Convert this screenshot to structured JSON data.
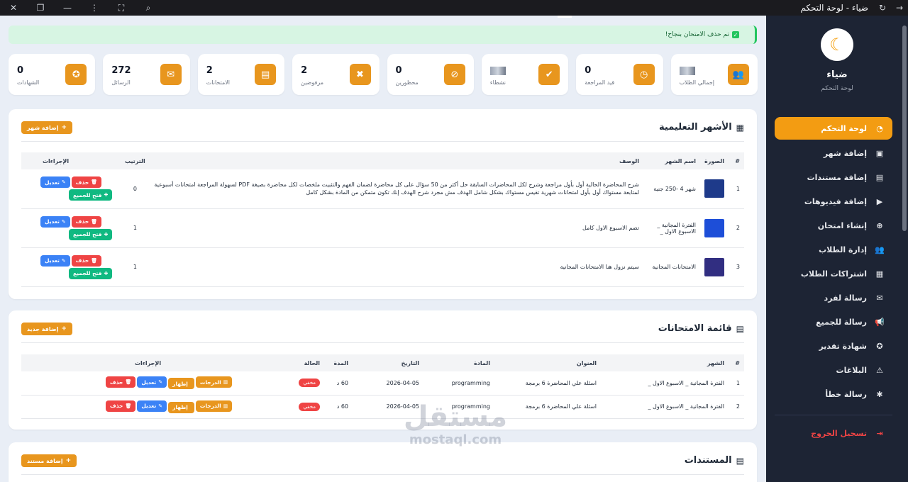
{
  "window": {
    "title": "ضياء - لوحة التحكم",
    "controls": {
      "close": "✕",
      "restore": "❐",
      "minimize": "—",
      "more": "⋮",
      "crop": "⛶",
      "zoom": "⌕"
    },
    "nav": {
      "refresh": "↻",
      "forward": "→"
    }
  },
  "sidebar": {
    "name": "ضياء",
    "subtitle": "لوحة التحكم",
    "items": [
      {
        "label": "لوحة التحكم",
        "icon": "gauge-icon",
        "glyph": "◔",
        "active": true
      },
      {
        "label": "إضافة شهر",
        "icon": "calendar-plus-icon",
        "glyph": "▣"
      },
      {
        "label": "إضافة مستندات",
        "icon": "file-icon",
        "glyph": "▤"
      },
      {
        "label": "إضافة فيديوهات",
        "icon": "video-icon",
        "glyph": "▶"
      },
      {
        "label": "إنشاء امتحان",
        "icon": "plus-circle-icon",
        "glyph": "⊕"
      },
      {
        "label": "إدارة الطلاب",
        "icon": "users-icon",
        "glyph": "👥"
      },
      {
        "label": "اشتراكات الطلاب",
        "icon": "calendar-check-icon",
        "glyph": "▦"
      },
      {
        "label": "رسالة لفرد",
        "icon": "envelope-icon",
        "glyph": "✉"
      },
      {
        "label": "رسالة للجميع",
        "icon": "bullhorn-icon",
        "glyph": "📢"
      },
      {
        "label": "شهادة تقدير",
        "icon": "award-icon",
        "glyph": "✪"
      },
      {
        "label": "البلاغات",
        "icon": "warning-icon",
        "glyph": "⚠"
      },
      {
        "label": "رسالة خطأ",
        "icon": "bug-icon",
        "glyph": "✱"
      }
    ],
    "logout": "تسجيل الخروج"
  },
  "alert": {
    "text": "تم حذف الامتحان بنجاح!"
  },
  "stats": [
    {
      "label": "إجمالي الطلاب",
      "value": "",
      "icon": "users-icon",
      "glyph": "👥",
      "blurred": true
    },
    {
      "label": "قيد المراجعة",
      "value": "0",
      "icon": "clock-icon",
      "glyph": "◷"
    },
    {
      "label": "نشطاء",
      "value": "",
      "icon": "user-check-icon",
      "glyph": "✔",
      "blurred": true
    },
    {
      "label": "محظورين",
      "value": "0",
      "icon": "ban-icon",
      "glyph": "⊘"
    },
    {
      "label": "مرفوضين",
      "value": "2",
      "icon": "x-circle-icon",
      "glyph": "✖"
    },
    {
      "label": "الامتحانات",
      "value": "2",
      "icon": "file-alt-icon",
      "glyph": "▤"
    },
    {
      "label": "الرسائل",
      "value": "272",
      "icon": "envelope-icon",
      "glyph": "✉"
    },
    {
      "label": "الشهادات",
      "value": "0",
      "icon": "certificate-icon",
      "glyph": "✪"
    }
  ],
  "months": {
    "title": "الأشهر التعليمية",
    "add_label": "إضافة شهر",
    "headers": [
      "#",
      "الصورة",
      "اسم الشهر",
      "الوصف",
      "الترتيب",
      "الإجراءات"
    ],
    "rows": [
      {
        "num": "1",
        "name": "شهر 4 -250 جنية",
        "desc": "شرح المحاضرة الحالية أول بأول مراجعة وشرح لكل المحاضرات السابقة حل أكثر من 50 سؤال على كل محاضرة لضمان الفهم والتثبيت ملخصات لكل محاضرة بصيغة PDF لسهولة المراجعة امتحانات أسبوعية لمتابعة مستواك أول بأول امتحانات شهرية تقيس مستواك بشكل شامل الهدف مش مجرد شرح الهدف إنك تكون متمكن من المادة بشكل كامل",
        "order": "0"
      },
      {
        "num": "2",
        "name": "الفترة المجانية _ الاسبوع الاول _",
        "desc": "تضم الاسبوع الاول كامل",
        "order": "1"
      },
      {
        "num": "3",
        "name": "الامتحانات المجانية",
        "desc": "سيتم نزول هنا الامتحانات المجانية",
        "order": "1"
      }
    ],
    "actions": {
      "delete": "حذف",
      "edit": "تعديل",
      "open": "فتح للجميع"
    }
  },
  "exams": {
    "title": "قائمة الامتحانات",
    "add_label": "إضافة جديد",
    "headers": [
      "#",
      "الشهر",
      "العنوان",
      "المادة",
      "التاريخ",
      "المدة",
      "الحالة",
      "الإجراءات"
    ],
    "rows": [
      {
        "num": "1",
        "month": "الفترة المجانية _ الاسبوع الاول _",
        "title": "اسئلة علي المحاضرة 6 برمجة",
        "subject": "programming",
        "date": "2026-04-05",
        "duration": "60 د",
        "status": "مخفي"
      },
      {
        "num": "2",
        "month": "الفترة المجانية _ الاسبوع الاول _",
        "title": "اسئلة علي المحاضرة 6 برمجة",
        "subject": "programming",
        "date": "2026-04-05",
        "duration": "60 د",
        "status": "مخفي"
      }
    ],
    "actions": {
      "grades": "الدرجات",
      "show": "إظهار",
      "edit": "تعديل",
      "delete": "حذف"
    }
  },
  "documents": {
    "title": "المستندات",
    "add_label": "إضافة مستند"
  },
  "watermark": {
    "line1": "مستقل",
    "line2": "mostaql.com"
  },
  "colors": {
    "accent": "#e8961e",
    "sidebar": "#1d2434",
    "danger": "#ef4444",
    "primary": "#3b82f6",
    "success": "#10b981"
  }
}
